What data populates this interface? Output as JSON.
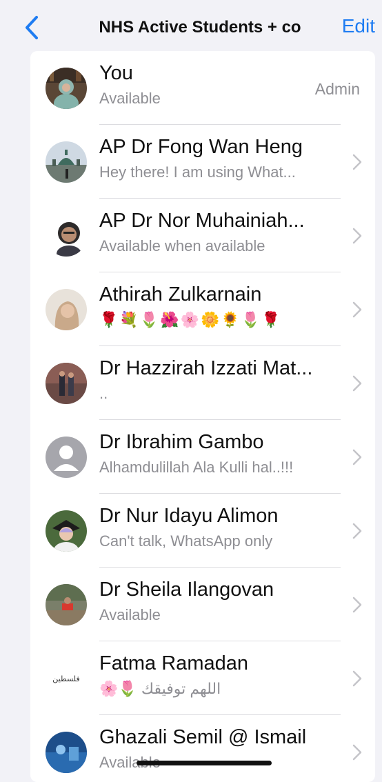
{
  "header": {
    "title": "NHS Active Students + co",
    "edit_label": "Edit"
  },
  "members": [
    {
      "name": "You",
      "status": "Available",
      "badge": "Admin"
    },
    {
      "name": "AP Dr Fong Wan Heng",
      "status": "Hey there! I am using What..."
    },
    {
      "name": "AP Dr Nor Muhainiah...",
      "status": "Available when available"
    },
    {
      "name": "Athirah Zulkarnain",
      "status": "🌹💐🌷🌺🌸🌼🌻🌷🌹"
    },
    {
      "name": "Dr Hazzirah Izzati Mat...",
      "status": ".."
    },
    {
      "name": "Dr Ibrahim Gambo",
      "status": "Alhamdulillah Ala Kulli hal..!!!"
    },
    {
      "name": "Dr Nur Idayu Alimon",
      "status": "Can't talk, WhatsApp only"
    },
    {
      "name": "Dr Sheila Ilangovan",
      "status": "Available"
    },
    {
      "name": "Fatma Ramadan",
      "status": "اللهم توفيقك 🌷🌸",
      "avatar_text": "ﻓﻠﺴﻄﻴﻦ"
    },
    {
      "name": "Ghazali Semil @ Ismail",
      "status": "Available"
    }
  ],
  "colors": {
    "accent": "#1e7cf2",
    "background": "#f2f2f7",
    "secondary_text": "#8e8e93"
  }
}
